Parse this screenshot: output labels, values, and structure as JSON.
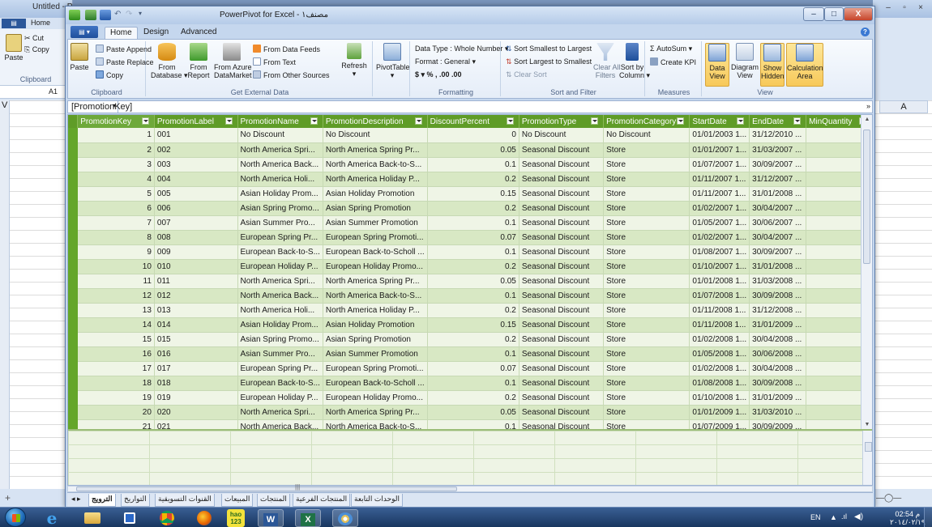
{
  "paint": {
    "title": "Untitled - Paint",
    "home_tab": "Home",
    "paste_label": "Paste",
    "cut_label": "Cut",
    "copy_label": "Copy",
    "clipboard_label": "Clipboard",
    "namebox": "A1",
    "col_v": "V"
  },
  "right_window": {
    "col_label": "A"
  },
  "window": {
    "title": "PowerPivot for Excel - مصنف۱",
    "min": "–",
    "max": "□",
    "close": "X"
  },
  "ribbon_tabs": {
    "file": "▤ ▾",
    "home": "Home",
    "design": "Design",
    "advanced": "Advanced"
  },
  "ribbon": {
    "clipboard": {
      "paste_append": "Paste Append",
      "paste_replace": "Paste Replace",
      "copy": "Copy",
      "paste": "Paste",
      "label": "Clipboard"
    },
    "external": {
      "from_database": "From",
      "from_database2": "Database ▾",
      "from_report": "From",
      "from_report2": "Report",
      "from_azure": "From Azure",
      "from_azure2": "DataMarket",
      "from_data_feeds": "From Data Feeds",
      "from_text": "From Text",
      "from_other": "From Other Sources",
      "refresh": "Refresh",
      "label": "Get External Data"
    },
    "pivottable": "PivotTable",
    "formatting": {
      "data_type": "Data Type : Whole Number ▾",
      "format": "Format : General ▾",
      "number_symbols": "$ ▾ %  ,  .00 .00",
      "label": "Formatting"
    },
    "sortfilter": {
      "sort_asc": "Sort Smallest to Largest",
      "sort_desc": "Sort Largest to Smallest",
      "clear_sort": "Clear Sort",
      "clear_all": "Clear All",
      "filters": "Filters",
      "sort_by": "Sort by",
      "column": "Column ▾",
      "label": "Sort and Filter"
    },
    "measures": {
      "autosum": "Σ AutoSum ▾",
      "create_kpi": "Create KPI",
      "label": "Measures"
    },
    "view": {
      "data": "Data",
      "view": "View",
      "diagram": "Diagram",
      "show": "Show",
      "hidden": "Hidden",
      "calculation": "Calculation",
      "area": "Area",
      "label": "View"
    }
  },
  "formula_bar": {
    "name": "[PromotionKey]",
    "expand": "»"
  },
  "columns": [
    "PromotionKey",
    "PromotionLabel",
    "PromotionName",
    "PromotionDescription",
    "DiscountPercent",
    "PromotionType",
    "PromotionCategory",
    "StartDate",
    "EndDate",
    "MinQuantity"
  ],
  "rows": [
    [
      "1",
      "001",
      "No Discount",
      "No Discount",
      "0",
      "No Discount",
      "No Discount",
      "01/01/2003 1...",
      "31/12/2010 ..."
    ],
    [
      "2",
      "002",
      "North America Spri...",
      "North America Spring Pr...",
      "0.05",
      "Seasonal Discount",
      "Store",
      "01/01/2007 1...",
      "31/03/2007 ..."
    ],
    [
      "3",
      "003",
      "North America Back...",
      "North America Back-to-S...",
      "0.1",
      "Seasonal Discount",
      "Store",
      "01/07/2007 1...",
      "30/09/2007 ..."
    ],
    [
      "4",
      "004",
      "North America Holi...",
      "North America Holiday P...",
      "0.2",
      "Seasonal Discount",
      "Store",
      "01/11/2007 1...",
      "31/12/2007 ..."
    ],
    [
      "5",
      "005",
      "Asian Holiday Prom...",
      "Asian Holiday Promotion",
      "0.15",
      "Seasonal Discount",
      "Store",
      "01/11/2007 1...",
      "31/01/2008 ..."
    ],
    [
      "6",
      "006",
      "Asian Spring Promo...",
      "Asian Spring Promotion",
      "0.2",
      "Seasonal Discount",
      "Store",
      "01/02/2007 1...",
      "30/04/2007 ..."
    ],
    [
      "7",
      "007",
      "Asian Summer Pro...",
      "Asian Summer Promotion",
      "0.1",
      "Seasonal Discount",
      "Store",
      "01/05/2007 1...",
      "30/06/2007 ..."
    ],
    [
      "8",
      "008",
      "European Spring Pr...",
      "European Spring Promoti...",
      "0.07",
      "Seasonal Discount",
      "Store",
      "01/02/2007 1...",
      "30/04/2007 ..."
    ],
    [
      "9",
      "009",
      "European Back-to-S...",
      "European Back-to-Scholl ...",
      "0.1",
      "Seasonal Discount",
      "Store",
      "01/08/2007 1...",
      "30/09/2007 ..."
    ],
    [
      "10",
      "010",
      "European Holiday P...",
      "European Holiday Promo...",
      "0.2",
      "Seasonal Discount",
      "Store",
      "01/10/2007 1...",
      "31/01/2008 ..."
    ],
    [
      "11",
      "011",
      "North America Spri...",
      "North America Spring Pr...",
      "0.05",
      "Seasonal Discount",
      "Store",
      "01/01/2008 1...",
      "31/03/2008 ..."
    ],
    [
      "12",
      "012",
      "North America Back...",
      "North America Back-to-S...",
      "0.1",
      "Seasonal Discount",
      "Store",
      "01/07/2008 1...",
      "30/09/2008 ..."
    ],
    [
      "13",
      "013",
      "North America Holi...",
      "North America Holiday P...",
      "0.2",
      "Seasonal Discount",
      "Store",
      "01/11/2008 1...",
      "31/12/2008 ..."
    ],
    [
      "14",
      "014",
      "Asian Holiday Prom...",
      "Asian Holiday Promotion",
      "0.15",
      "Seasonal Discount",
      "Store",
      "01/11/2008 1...",
      "31/01/2009 ..."
    ],
    [
      "15",
      "015",
      "Asian Spring Promo...",
      "Asian Spring Promotion",
      "0.2",
      "Seasonal Discount",
      "Store",
      "01/02/2008 1...",
      "30/04/2008 ..."
    ],
    [
      "16",
      "016",
      "Asian Summer Pro...",
      "Asian Summer Promotion",
      "0.1",
      "Seasonal Discount",
      "Store",
      "01/05/2008 1...",
      "30/06/2008 ..."
    ],
    [
      "17",
      "017",
      "European Spring Pr...",
      "European Spring Promoti...",
      "0.07",
      "Seasonal Discount",
      "Store",
      "01/02/2008 1...",
      "30/04/2008 ..."
    ],
    [
      "18",
      "018",
      "European Back-to-S...",
      "European Back-to-Scholl ...",
      "0.1",
      "Seasonal Discount",
      "Store",
      "01/08/2008 1...",
      "30/09/2008 ..."
    ],
    [
      "19",
      "019",
      "European Holiday P...",
      "European Holiday Promo...",
      "0.2",
      "Seasonal Discount",
      "Store",
      "01/10/2008 1...",
      "31/01/2009 ..."
    ],
    [
      "20",
      "020",
      "North America Spri...",
      "North America Spring Pr...",
      "0.05",
      "Seasonal Discount",
      "Store",
      "01/01/2009 1...",
      "31/03/2010 ..."
    ],
    [
      "21",
      "021",
      "North America Back...",
      "North America Back-to-S...",
      "0.1",
      "Seasonal Discount",
      "Store",
      "01/07/2009 1...",
      "30/09/2009 ..."
    ],
    [
      "22",
      "022",
      "North America Holi...",
      "North America Holiday P...",
      "0.2",
      "Seasonal Discount",
      "Store",
      "01/11/2009 1...",
      "31/12/2009 ..."
    ],
    [
      "23",
      "023",
      "Asian Holiday Prom...",
      "Asian Holiday Promotion",
      "0.15",
      "Seasonal Discount",
      "Store",
      "01/11/2009 1...",
      "31/01/2010 ..."
    ],
    [
      "24",
      "024",
      "Asian Spring Promo...",
      "Asian Spring Promotion",
      "0.2",
      "Seasonal Discount",
      "Store",
      "01/02/2009 1...",
      "30/04/2009 ..."
    ]
  ],
  "sheet_tabs": [
    "الترويج",
    "التواريخ",
    "القنوات التسويقية",
    "المبيعات",
    "المنتجات",
    "المنتجات الفرعية",
    "الوحدات التابعة"
  ],
  "taskbar": {
    "icons": [
      "windows-start",
      "internet-explorer",
      "file-explorer",
      "media-player",
      "chrome",
      "firefox",
      "hao123",
      "word",
      "excel",
      "paint"
    ],
    "hao123": "hao 123",
    "word": "W",
    "excel": "X",
    "lang": "EN",
    "clock_time": "02:54 م",
    "clock_date": "٢٠١٤/٠٢/١٩"
  },
  "colors": {
    "grid_header": "#5f9c27",
    "row_odd": "#eff5e6",
    "row_even": "#d8e8c4",
    "ribbon_highlight": "#f7c95a"
  }
}
